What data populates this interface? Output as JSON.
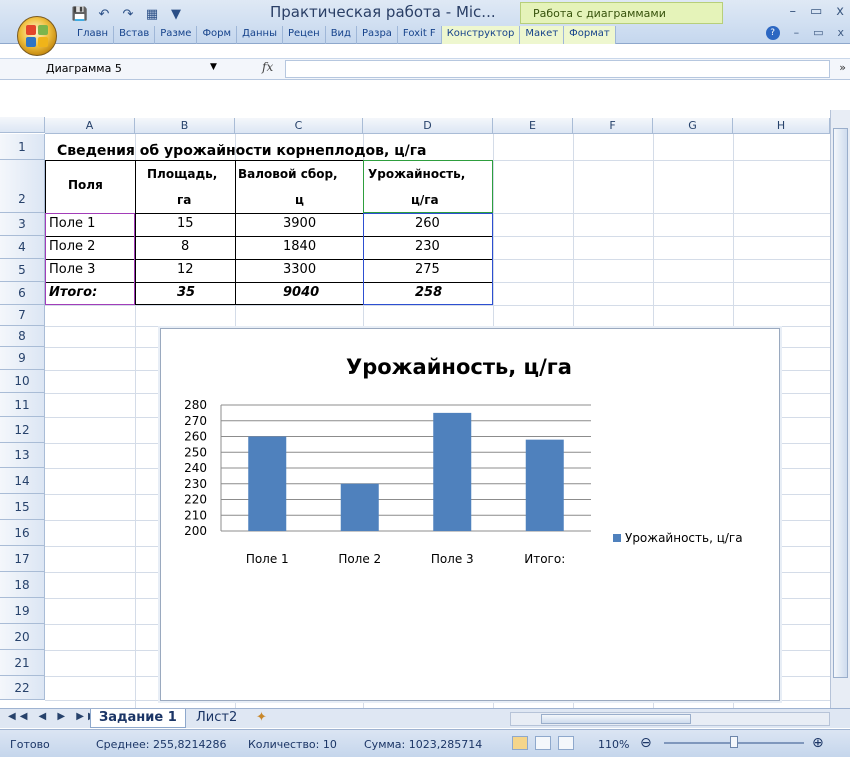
{
  "window": {
    "title": "Практическая работа - Mic...",
    "context_tab": "Работа с диаграммами",
    "controls": [
      "–",
      "▭",
      "x"
    ]
  },
  "ribbon": {
    "tabs": [
      "Главн",
      "Встав",
      "Разме",
      "Форм",
      "Данны",
      "Рецен",
      "Вид",
      "Разра",
      "Foxit F",
      "Конструктор",
      "Макет",
      "Формат"
    ],
    "help_icon": "help-icon",
    "right_controls": [
      "–",
      "▭",
      "x"
    ]
  },
  "quick_access": [
    "save-icon",
    "undo-icon",
    "redo-icon",
    "table-icon",
    "customize-icon"
  ],
  "formula_bar": {
    "name_box": "Диаграмма 5",
    "fx_label": "fx",
    "value": ""
  },
  "columns": [
    "A",
    "B",
    "C",
    "D",
    "E",
    "F",
    "G",
    "H"
  ],
  "rows": [
    "1",
    "2",
    "3",
    "4",
    "5",
    "6",
    "7",
    "8",
    "9",
    "10",
    "11",
    "12",
    "13",
    "14",
    "15",
    "16",
    "17",
    "18",
    "19",
    "20",
    "21",
    "22"
  ],
  "sheet": {
    "title": "Сведения об урожайности корнеплодов, ц/га",
    "headers": [
      {
        "l1": "Поля",
        "l2": ""
      },
      {
        "l1": "Площадь,",
        "l2": "га"
      },
      {
        "l1": "Валовой сбор,",
        "l2": "ц"
      },
      {
        "l1": "Урожайность,",
        "l2": "ц/га"
      }
    ],
    "data_rows": [
      [
        "Поле 1",
        "15",
        "3900",
        "260"
      ],
      [
        "Поле 2",
        "8",
        "1840",
        "230"
      ],
      [
        "Поле 3",
        "12",
        "3300",
        "275"
      ]
    ],
    "total_row": [
      "Итого:",
      "35",
      "9040",
      "258"
    ]
  },
  "chart_data": {
    "type": "bar",
    "title": "Урожайность, ц/га",
    "categories": [
      "Поле 1",
      "Поле 2",
      "Поле 3",
      "Итого:"
    ],
    "series": [
      {
        "name": "Урожайность, ц/га",
        "values": [
          260,
          230,
          275,
          258
        ]
      }
    ],
    "ylim": [
      200,
      280
    ],
    "yticks": [
      200,
      210,
      220,
      230,
      240,
      250,
      260,
      270,
      280
    ],
    "grid": true,
    "legend_position": "right",
    "color": "#4f81bd"
  },
  "sheet_tabs": {
    "nav": "◀◀ ◀ ▶ ▶▶",
    "tabs": [
      "Задание 1",
      "Лист2"
    ],
    "active": "Задание 1"
  },
  "status": {
    "ready": "Готово",
    "average": "Среднее: 255,8214286",
    "count": "Количество: 10",
    "sum": "Сумма: 1023,285714",
    "zoom": "110%"
  }
}
